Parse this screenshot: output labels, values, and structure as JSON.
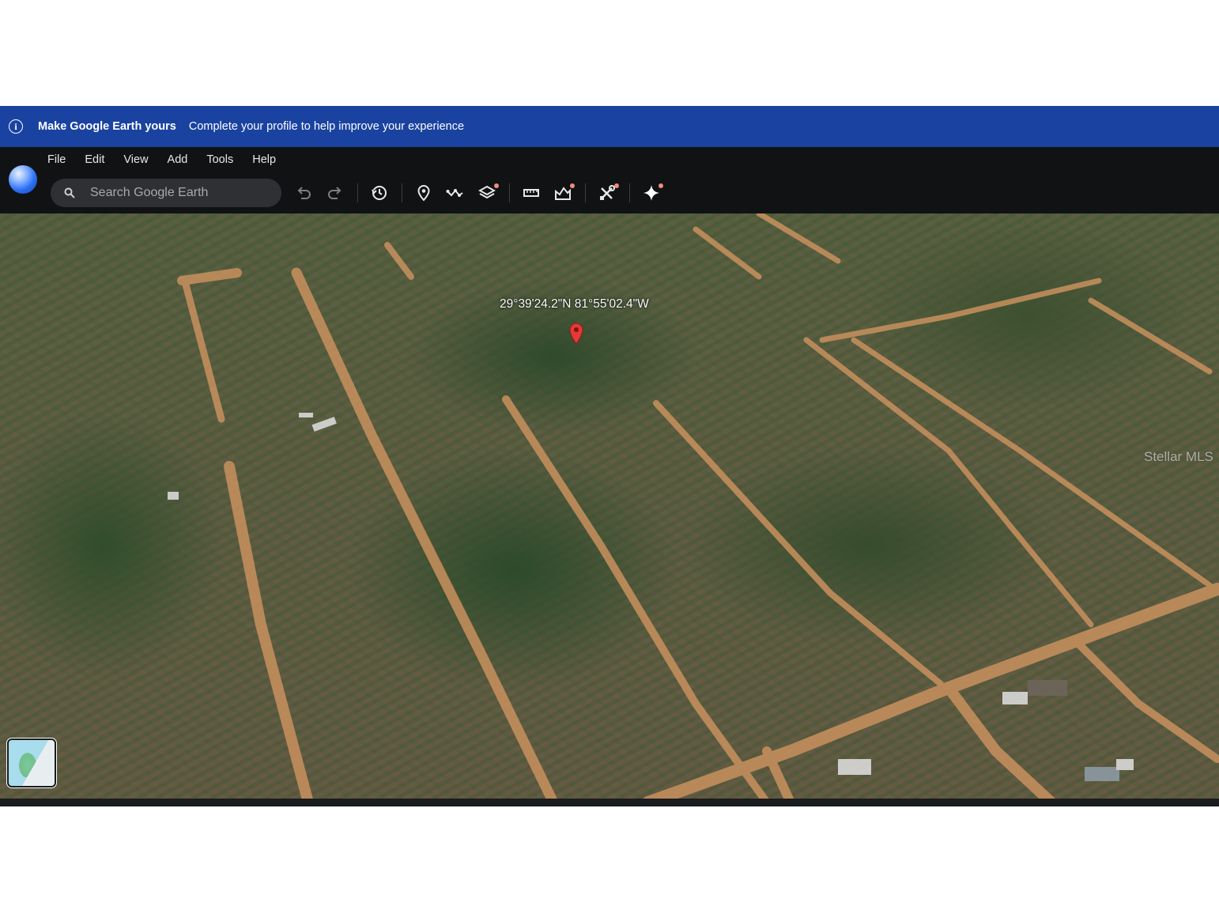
{
  "banner": {
    "icon": "info-icon",
    "title": "Make Google Earth yours",
    "subtitle": "Complete your profile to help improve your experience"
  },
  "menu": {
    "items": [
      "File",
      "Edit",
      "View",
      "Add",
      "Tools",
      "Help"
    ]
  },
  "search": {
    "placeholder": "Search Google Earth"
  },
  "toolbar": {
    "icons": [
      "undo-icon",
      "redo-icon",
      "history-icon",
      "placemark-icon",
      "path-icon",
      "layers-icon",
      "ruler-icon",
      "elevation-icon",
      "tools-icon",
      "gemini-sparkle-icon"
    ]
  },
  "map": {
    "coordinates": "29°39'24.2\"N 81°55'02.4\"W",
    "watermark": "Stellar MLS",
    "pin_color": "#e53935"
  },
  "colors": {
    "banner": "#1a43a1",
    "toolbar": "#111214",
    "notification_dot": "#f28b82"
  }
}
